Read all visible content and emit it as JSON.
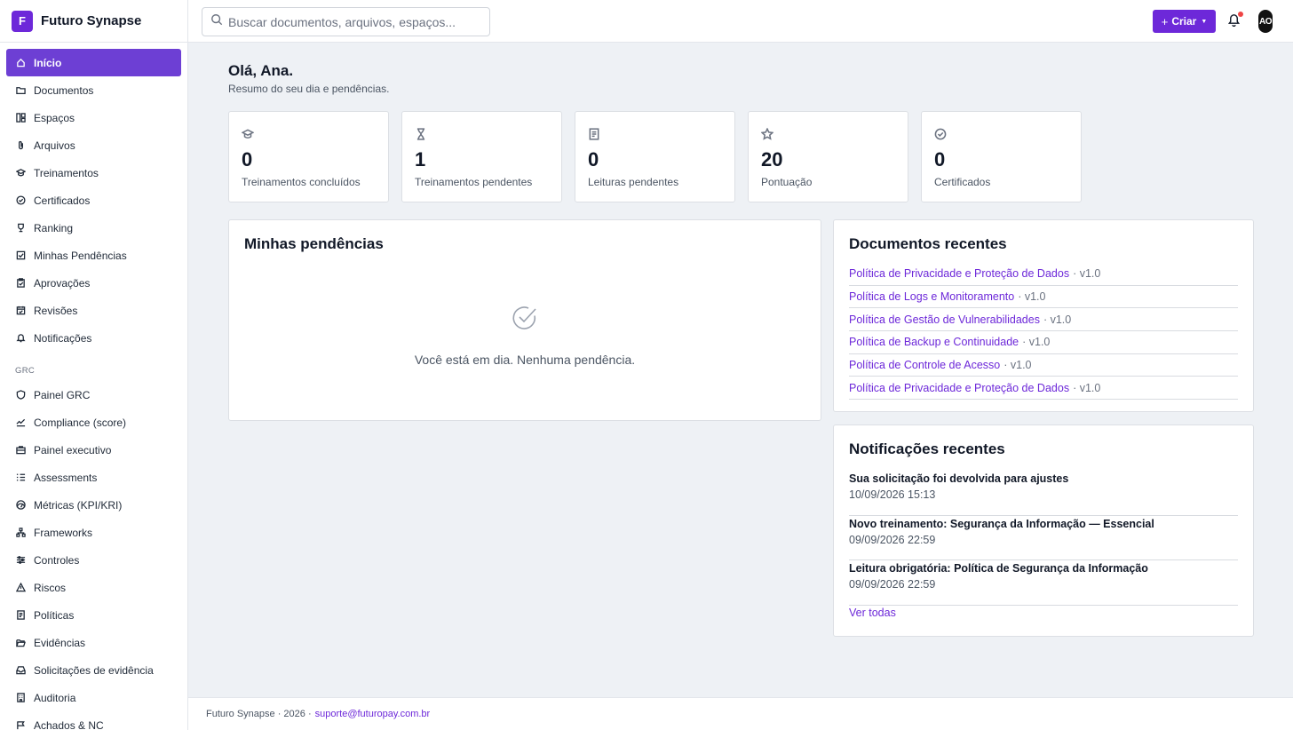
{
  "brand": {
    "logo_letter": "F",
    "name": "Futuro Synapse"
  },
  "sidebar": {
    "items": [
      {
        "label": "Início",
        "icon": "home-icon",
        "active": true
      },
      {
        "label": "Documentos",
        "icon": "folder-icon"
      },
      {
        "label": "Espaços",
        "icon": "layout-icon"
      },
      {
        "label": "Arquivos",
        "icon": "paperclip-icon"
      },
      {
        "label": "Treinamentos",
        "icon": "graduation-cap-icon"
      },
      {
        "label": "Certificados",
        "icon": "badge-check-icon"
      },
      {
        "label": "Ranking",
        "icon": "trophy-icon"
      },
      {
        "label": "Minhas Pendências",
        "icon": "check-square-icon"
      },
      {
        "label": "Aprovações",
        "icon": "clipboard-check-icon"
      },
      {
        "label": "Revisões",
        "icon": "calendar-check-icon"
      },
      {
        "label": "Notificações",
        "icon": "bell-icon"
      }
    ],
    "section_label": "GRC",
    "grc_items": [
      {
        "label": "Painel GRC",
        "icon": "shield-icon"
      },
      {
        "label": "Compliance (score)",
        "icon": "trending-up-icon"
      },
      {
        "label": "Painel executivo",
        "icon": "briefcase-icon"
      },
      {
        "label": "Assessments",
        "icon": "list-checks-icon"
      },
      {
        "label": "Métricas (KPI/KRI)",
        "icon": "gauge-icon"
      },
      {
        "label": "Frameworks",
        "icon": "network-icon"
      },
      {
        "label": "Controles",
        "icon": "sliders-icon"
      },
      {
        "label": "Riscos",
        "icon": "alert-triangle-icon"
      },
      {
        "label": "Políticas",
        "icon": "file-text-icon"
      },
      {
        "label": "Evidências",
        "icon": "folder-open-icon"
      },
      {
        "label": "Solicitações de evidência",
        "icon": "inbox-icon"
      },
      {
        "label": "Auditoria",
        "icon": "building-icon"
      },
      {
        "label": "Achados & NC",
        "icon": "flag-icon"
      }
    ]
  },
  "topbar": {
    "search_placeholder": "Buscar documentos, arquivos, espaços...",
    "create_label": "Criar",
    "avatar_initials": "AO"
  },
  "greeting": {
    "title": "Olá, Ana.",
    "subtitle": "Resumo do seu dia e pendências."
  },
  "stats": [
    {
      "value": "0",
      "label": "Treinamentos concluídos",
      "icon": "graduation-cap-icon"
    },
    {
      "value": "1",
      "label": "Treinamentos pendentes",
      "icon": "hourglass-icon"
    },
    {
      "value": "0",
      "label": "Leituras pendentes",
      "icon": "file-text-icon"
    },
    {
      "value": "20",
      "label": "Pontuação",
      "icon": "star-icon"
    },
    {
      "value": "0",
      "label": "Certificados",
      "icon": "badge-check-icon"
    }
  ],
  "pending": {
    "title": "Minhas pendências",
    "empty_message": "Você está em dia. Nenhuma pendência."
  },
  "recent_docs": {
    "title": "Documentos recentes",
    "items": [
      {
        "name": "Política de Privacidade e Proteção de Dados",
        "version": "· v1.0"
      },
      {
        "name": "Política de Logs e Monitoramento",
        "version": "· v1.0"
      },
      {
        "name": "Política de Gestão de Vulnerabilidades",
        "version": "· v1.0"
      },
      {
        "name": "Política de Backup e Continuidade",
        "version": "· v1.0"
      },
      {
        "name": "Política de Controle de Acesso",
        "version": "· v1.0"
      },
      {
        "name": "Política de Privacidade e Proteção de Dados",
        "version": "· v1.0"
      }
    ]
  },
  "recent_notifications": {
    "title": "Notificações recentes",
    "items": [
      {
        "title": "Sua solicitação foi devolvida para ajustes",
        "date": "10/09/2026 15:13"
      },
      {
        "title": "Novo treinamento: Segurança da Informação — Essencial",
        "date": "09/09/2026 22:59"
      },
      {
        "title": "Leitura obrigatória: Política de Segurança da Informação",
        "date": "09/09/2026 22:59"
      }
    ],
    "see_all": "Ver todas"
  },
  "footer": {
    "text": "Futuro Synapse · 2026 ·",
    "email": "suporte@futuropay.com.br"
  },
  "colors": {
    "accent": "#6d28d9",
    "background": "#eef1f5",
    "notification_dot": "#ef4444"
  }
}
